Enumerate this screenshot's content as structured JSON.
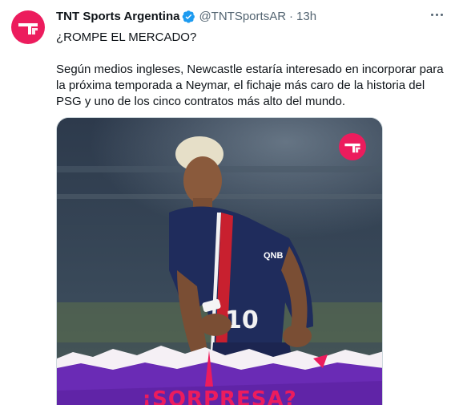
{
  "account": {
    "display_name": "TNT Sports Argentina",
    "handle": "@TNTSportsAR",
    "separator": "·",
    "time": "13h",
    "verified_icon": "verified-badge-icon",
    "avatar_icon": "tnt-logo-icon"
  },
  "tweet": {
    "title_line": "¿ROMPE EL MERCADO?",
    "body": "Según medios ingleses, Newcastle estaría interesado en incorporar para la próxima temporada a Neymar, el fichaje más caro de la historia del PSG y uno de los cinco contratos más alto del mundo."
  },
  "media": {
    "headline": "¡SORPRESA?",
    "jersey_number": "10",
    "sponsor": "QNB",
    "logo_icon": "tnt-logo-icon"
  },
  "colors": {
    "brand_pink": "#ec1c5d",
    "verified_blue": "#1d9bf0",
    "banner_purple": "#6a2bb5"
  }
}
